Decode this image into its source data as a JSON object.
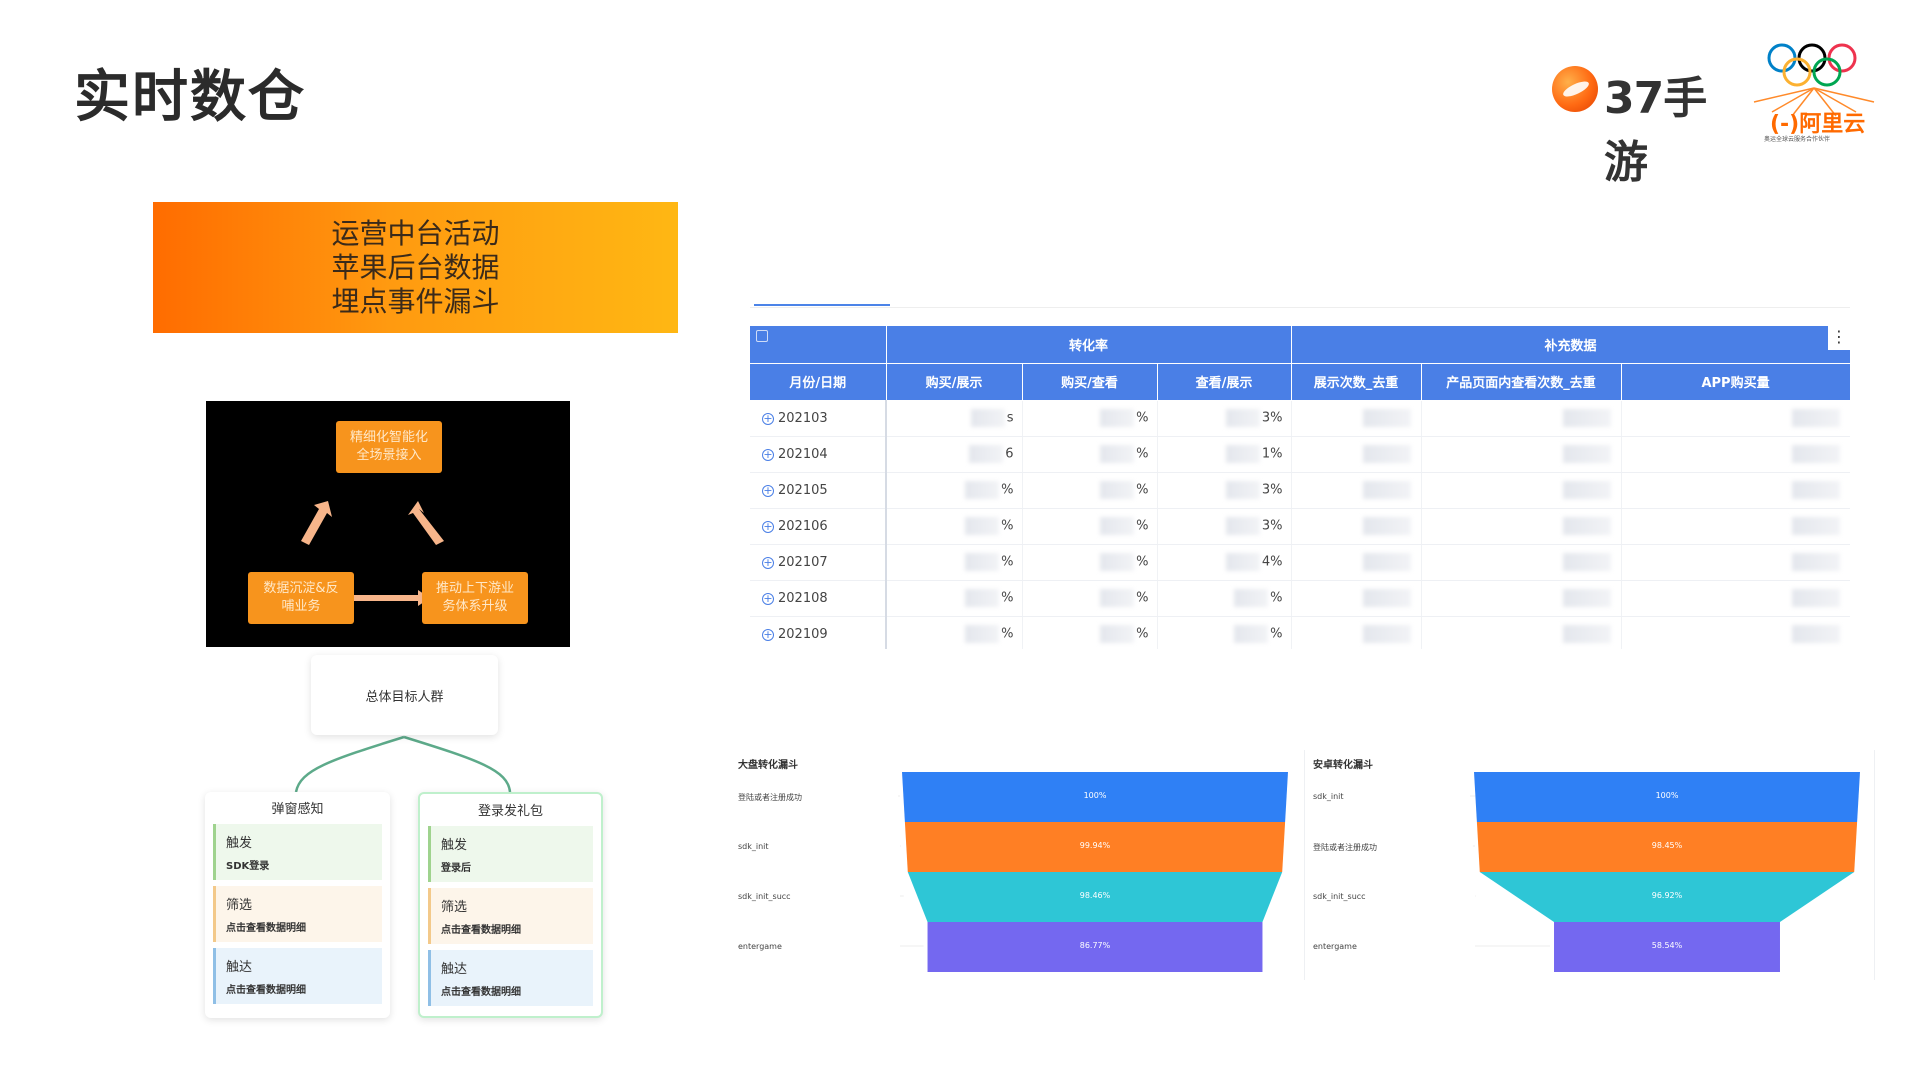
{
  "header": {
    "title": "实时数仓",
    "logo_text": "37手游",
    "partner_text": "(-)阿里云",
    "partner_tagline": "奥运全球云服务合作伙伴"
  },
  "banner": {
    "lines": [
      "运营中台活动",
      "苹果后台数据",
      "埋点事件漏斗"
    ]
  },
  "loop": {
    "top": "精细化智能化\n全场景接入",
    "left": "数据沉淀&反\n哺业务",
    "right": "推动上下游业\n务体系升级"
  },
  "targets": {
    "root": "总体目标人群",
    "branches": [
      {
        "title": "弹窗感知",
        "steps": [
          {
            "name": "触发",
            "detail": "SDK登录"
          },
          {
            "name": "筛选",
            "detail": "点击查看数据明细"
          },
          {
            "name": "触达",
            "detail": "点击查看数据明细"
          }
        ]
      },
      {
        "title": "登录发礼包",
        "steps": [
          {
            "name": "触发",
            "detail": "登录后"
          },
          {
            "name": "筛选",
            "detail": "点击查看数据明细"
          },
          {
            "name": "触达",
            "detail": "点击查看数据明细"
          }
        ]
      }
    ]
  },
  "table": {
    "group_headers": [
      "转化率",
      "补充数据"
    ],
    "columns": [
      "月份/日期",
      "购买/展示",
      "购买/查看",
      "查看/展示",
      "展示次数_去重",
      "产品页面内查看次数_去重",
      "APP购买量"
    ],
    "rows": [
      {
        "date": "202103",
        "c1": "s",
        "c2": "%",
        "c3": "3%"
      },
      {
        "date": "202104",
        "c1": "6",
        "c2": "%",
        "c3": "1%"
      },
      {
        "date": "202105",
        "c1": "%",
        "c2": "%",
        "c3": "3%"
      },
      {
        "date": "202106",
        "c1": "%",
        "c2": "%",
        "c3": "3%"
      },
      {
        "date": "202107",
        "c1": "%",
        "c2": "%",
        "c3": "4%"
      },
      {
        "date": "202108",
        "c1": "%",
        "c2": "%",
        "c3": "%"
      },
      {
        "date": "202109",
        "c1": "%",
        "c2": "%",
        "c3": "%"
      }
    ]
  },
  "funnels": [
    {
      "title": "大盘转化漏斗",
      "stages": [
        {
          "label": "登陆或者注册成功",
          "value": "100%",
          "width": 1.0,
          "color": "#2f80f5"
        },
        {
          "label": "sdk_init",
          "value": "99.94%",
          "width": 0.9994,
          "color": "#ff7f24"
        },
        {
          "label": "sdk_init_succ",
          "value": "98.46%",
          "width": 0.9846,
          "color": "#2ec6d6"
        },
        {
          "label": "entergame",
          "value": "86.77%",
          "width": 0.8677,
          "color": "#7468f0"
        }
      ]
    },
    {
      "title": "安卓转化漏斗",
      "stages": [
        {
          "label": "sdk_init",
          "value": "100%",
          "width": 1.0,
          "color": "#2f80f5"
        },
        {
          "label": "登陆或者注册成功",
          "value": "98.45%",
          "width": 0.9845,
          "color": "#ff7f24"
        },
        {
          "label": "sdk_init_succ",
          "value": "96.92%",
          "width": 0.9692,
          "color": "#2ec6d6"
        },
        {
          "label": "entergame",
          "value": "58.54%",
          "width": 0.5854,
          "color": "#7468f0"
        }
      ]
    }
  ]
}
